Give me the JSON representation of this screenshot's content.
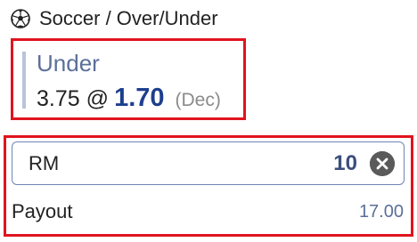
{
  "header": {
    "icon": "soccer-ball-icon",
    "title": "Soccer / Over/Under"
  },
  "selection": {
    "name": "Under",
    "handicap": "3.75",
    "at": "@",
    "odds": "1.70",
    "odds_format": "(Dec)"
  },
  "stake": {
    "currency": "RM",
    "amount": "10",
    "clear_icon": "clear-circle-x-icon"
  },
  "payout": {
    "label": "Payout",
    "value": "17.00"
  },
  "colors": {
    "highlight_border": "#e0141e",
    "odds_blue": "#1e3f8e",
    "selection_name": "#5b6f99",
    "input_border": "#6e86b3"
  }
}
